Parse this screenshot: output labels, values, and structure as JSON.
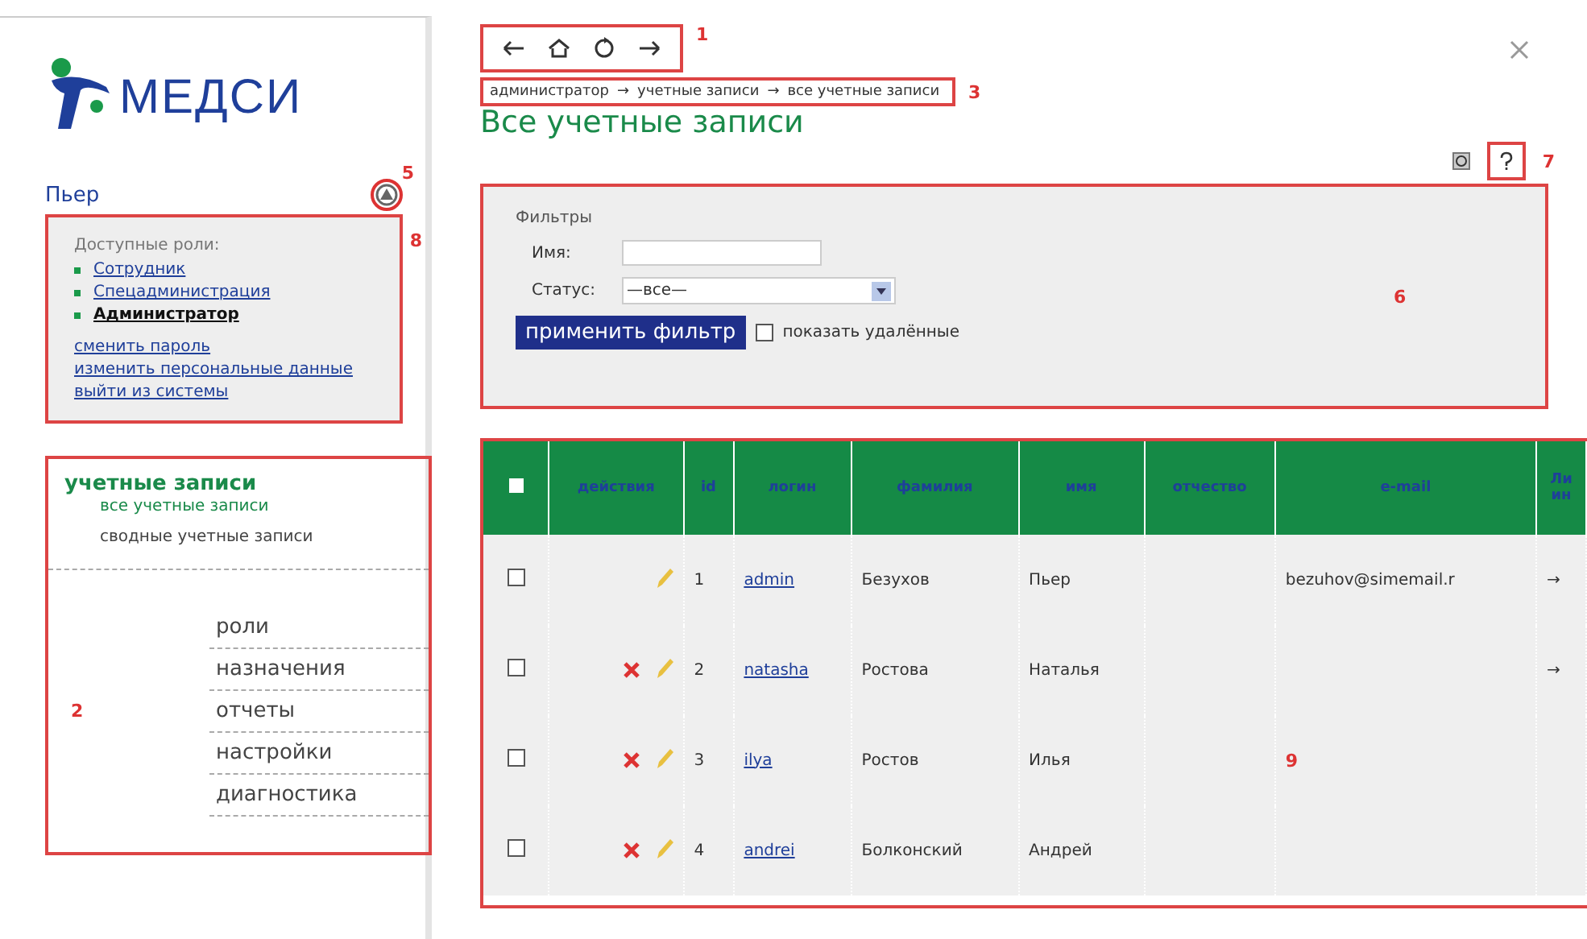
{
  "logo": {
    "name": "МЕДСИ"
  },
  "user": {
    "name": "Пьер",
    "roles_label": "Доступные роли:",
    "roles": [
      {
        "label": "Сотрудник",
        "selected": false
      },
      {
        "label": "Спецадминистрация",
        "selected": false
      },
      {
        "label": "Администратор",
        "selected": true
      }
    ],
    "links": [
      "сменить пароль",
      "изменить персональные данные",
      "выйти из системы"
    ]
  },
  "sidebar": {
    "section": "учетные записи",
    "items": [
      {
        "label": "все учетные записи",
        "selected": true
      },
      {
        "label": "сводные учетные записи",
        "selected": false
      }
    ],
    "menu": [
      "роли",
      "назначения",
      "отчеты",
      "настройки",
      "диагностика"
    ]
  },
  "breadcrumb": [
    "администратор",
    "учетные записи",
    "все учетные записи"
  ],
  "breadcrumb_separator": "→",
  "title": "Все учетные записи",
  "filter": {
    "title": "Фильтры",
    "name_label": "Имя:",
    "status_label": "Статус:",
    "status_value": "—все—",
    "apply": "применить фильтр",
    "option": {
      "label": "показать удалённые",
      "checked": false
    }
  },
  "table": {
    "select_all": {
      "checked": false
    },
    "columns": [
      "действия",
      "id",
      "логин",
      "фамилия",
      "имя",
      "отчество",
      "e-mail",
      "Ли ин"
    ],
    "rows": [
      {
        "checked": false,
        "deletable": false,
        "id": "1",
        "login": "admin",
        "last": "Безухов",
        "first": "Пьер",
        "middle": "",
        "email": "bezuhov@simemail.r",
        "arrow": "→"
      },
      {
        "checked": false,
        "deletable": true,
        "id": "2",
        "login": "natasha",
        "last": "Ростова",
        "first": "Наталья",
        "middle": "",
        "email": "",
        "arrow": "→"
      },
      {
        "checked": false,
        "deletable": true,
        "id": "3",
        "login": "ilya",
        "last": "Ростов",
        "first": "Илья",
        "middle": "",
        "email": "",
        "arrow": ""
      },
      {
        "checked": false,
        "deletable": true,
        "id": "4",
        "login": "andrei",
        "last": "Болконский",
        "first": "Андрей",
        "middle": "",
        "email": "",
        "arrow": ""
      }
    ]
  },
  "annotations": {
    "nav": "1",
    "sidebar": "2",
    "breadcrumb": "3",
    "settings": "5",
    "filter": "6",
    "help": "7",
    "user": "8",
    "table": "9"
  }
}
